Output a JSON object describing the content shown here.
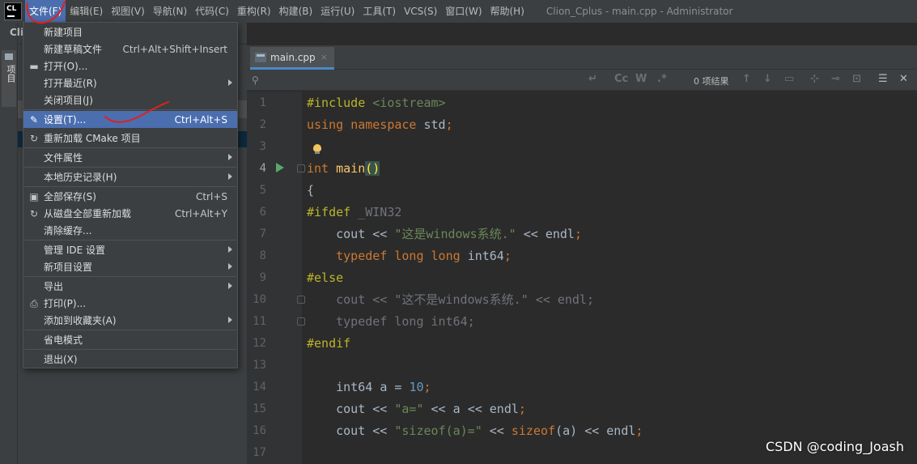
{
  "menubar": {
    "logo": "CL",
    "items": [
      "文件(F)",
      "编辑(E)",
      "视图(V)",
      "导航(N)",
      "代码(C)",
      "重构(R)",
      "构建(B)",
      "运行(U)",
      "工具(T)",
      "VCS(S)",
      "窗口(W)",
      "帮助(H)"
    ],
    "window_title": "Clion_Cplus - main.cpp - Administrator"
  },
  "left_strip": {
    "project_tab": "项目"
  },
  "project_panel": {
    "title": "Cli"
  },
  "editor": {
    "tab_label": "main.cpp",
    "tab_close": "×",
    "search": {
      "placeholder": "",
      "result_count": "0 项结果"
    },
    "lines": [
      "1",
      "2",
      "3",
      "4",
      "5",
      "6",
      "7",
      "8",
      "9",
      "10",
      "11",
      "12",
      "13",
      "14",
      "15",
      "16",
      "17"
    ]
  },
  "dropdown": {
    "items": [
      {
        "label": "新建项目",
        "shortcut": ""
      },
      {
        "label": "新建草稿文件",
        "shortcut": "Ctrl+Alt+Shift+Insert"
      },
      {
        "label": "打开(O)...",
        "shortcut": ""
      },
      {
        "label": "打开最近(R)",
        "shortcut": ""
      },
      {
        "label": "关闭项目(J)",
        "shortcut": ""
      },
      {
        "label": "设置(T)...",
        "shortcut": "Ctrl+Alt+S"
      },
      {
        "label": "重新加载 CMake 项目",
        "shortcut": ""
      },
      {
        "label": "文件属性",
        "shortcut": ""
      },
      {
        "label": "本地历史记录(H)",
        "shortcut": ""
      },
      {
        "label": "全部保存(S)",
        "shortcut": "Ctrl+S"
      },
      {
        "label": "从磁盘全部重新加载",
        "shortcut": "Ctrl+Alt+Y"
      },
      {
        "label": "清除缓存...",
        "shortcut": ""
      },
      {
        "label": "管理 IDE 设置",
        "shortcut": ""
      },
      {
        "label": "新项目设置",
        "shortcut": ""
      },
      {
        "label": "导出",
        "shortcut": ""
      },
      {
        "label": "打印(P)...",
        "shortcut": ""
      },
      {
        "label": "添加到收藏夹(A)",
        "shortcut": ""
      },
      {
        "label": "省电模式",
        "shortcut": ""
      },
      {
        "label": "退出(X)",
        "shortcut": ""
      }
    ]
  },
  "watermark": "CSDN @coding_Joash",
  "colors": {
    "accent": "#4b6eaf",
    "keyword": "#cc7832",
    "string": "#6a8759",
    "number": "#6897bb",
    "function": "#ffc66d",
    "preprocessor": "#bbb529",
    "annotation_red": "#e02020"
  }
}
